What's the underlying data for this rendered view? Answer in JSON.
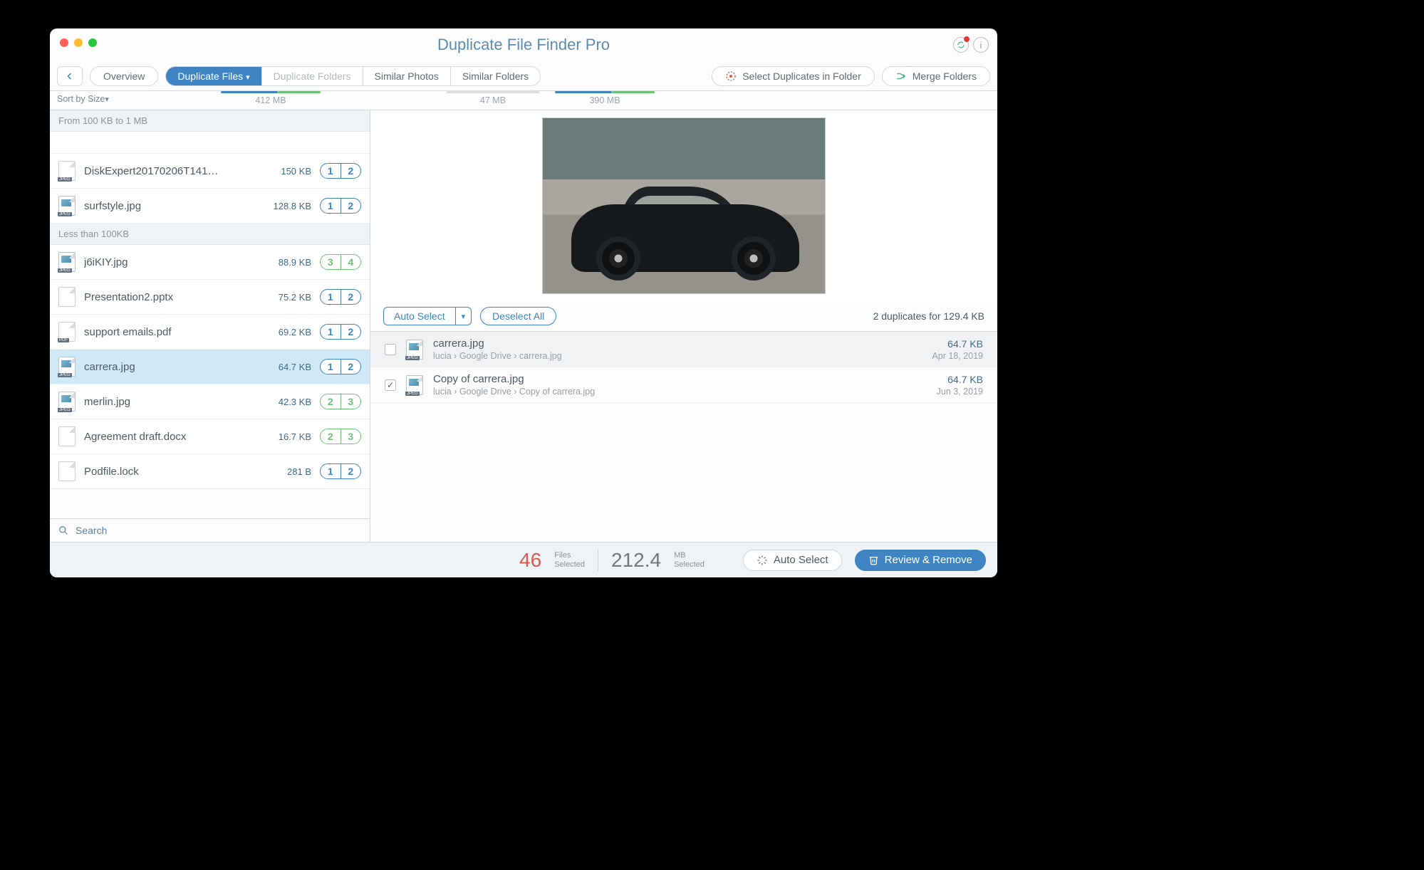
{
  "app_title": "Duplicate File Finder Pro",
  "toolbar": {
    "overview": "Overview",
    "tabs": {
      "dup_files": "Duplicate Files",
      "dup_folders": "Duplicate Folders",
      "sim_photos": "Similar Photos",
      "sim_folders": "Similar Folders"
    },
    "metrics": {
      "dup_files_size": "412 MB",
      "sim_photos_size": "47 MB",
      "sim_folders_size": "390 MB"
    },
    "select_in_folder": "Select Duplicates in Folder",
    "merge_folders": "Merge Folders"
  },
  "sidebar": {
    "sort_label": "Sort by Size",
    "group1": "From 100 KB to 1 MB",
    "group2": "Less than 100KB",
    "search_placeholder": "Search",
    "rows": [
      {
        "name": "DiskExpert20170206T141…",
        "size": "150 KB",
        "b1": "1",
        "b2": "2",
        "icon": "doc",
        "style": "blue"
      },
      {
        "name": "surfstyle.jpg",
        "size": "128.8 KB",
        "b1": "1",
        "b2": "2",
        "icon": "jpeg",
        "style": "blue"
      },
      {
        "name": "j6iKIY.jpg",
        "size": "88.9 KB",
        "b1": "3",
        "b2": "4",
        "icon": "jpeg",
        "style": "green"
      },
      {
        "name": "Presentation2.pptx",
        "size": "75.2 KB",
        "b1": "1",
        "b2": "2",
        "icon": "doc",
        "style": "blue"
      },
      {
        "name": "support emails.pdf",
        "size": "69.2 KB",
        "b1": "1",
        "b2": "2",
        "icon": "pdf",
        "style": "blue"
      },
      {
        "name": "carrera.jpg",
        "size": "64.7 KB",
        "b1": "1",
        "b2": "2",
        "icon": "jpeg",
        "style": "blue"
      },
      {
        "name": "merlin.jpg",
        "size": "42.3 KB",
        "b1": "2",
        "b2": "3",
        "icon": "jpeg",
        "style": "green"
      },
      {
        "name": "Agreement draft.docx",
        "size": "16.7 KB",
        "b1": "2",
        "b2": "3",
        "icon": "doc",
        "style": "green"
      },
      {
        "name": "Podfile.lock",
        "size": "281 B",
        "b1": "1",
        "b2": "2",
        "icon": "doc",
        "style": "blue"
      }
    ]
  },
  "detail": {
    "auto_select": "Auto Select",
    "deselect_all": "Deselect All",
    "summary": "2 duplicates for 129.4 KB",
    "dups": [
      {
        "name": "carrera.jpg",
        "path": "lucia  ›  Google Drive  ›  carrera.jpg",
        "size": "64.7 KB",
        "date": "Apr 18, 2019",
        "checked": false
      },
      {
        "name": "Copy of carrera.jpg",
        "path": "lucia  ›  Google Drive  ›  Copy of carrera.jpg",
        "size": "64.7 KB",
        "date": "Jun 3, 2019",
        "checked": true
      }
    ]
  },
  "footer": {
    "files_count": "46",
    "files_label_1": "Files",
    "files_label_2": "Selected",
    "size_count": "212.4",
    "size_label_1": "MB",
    "size_label_2": "Selected",
    "auto_select": "Auto Select",
    "review": "Review & Remove"
  }
}
